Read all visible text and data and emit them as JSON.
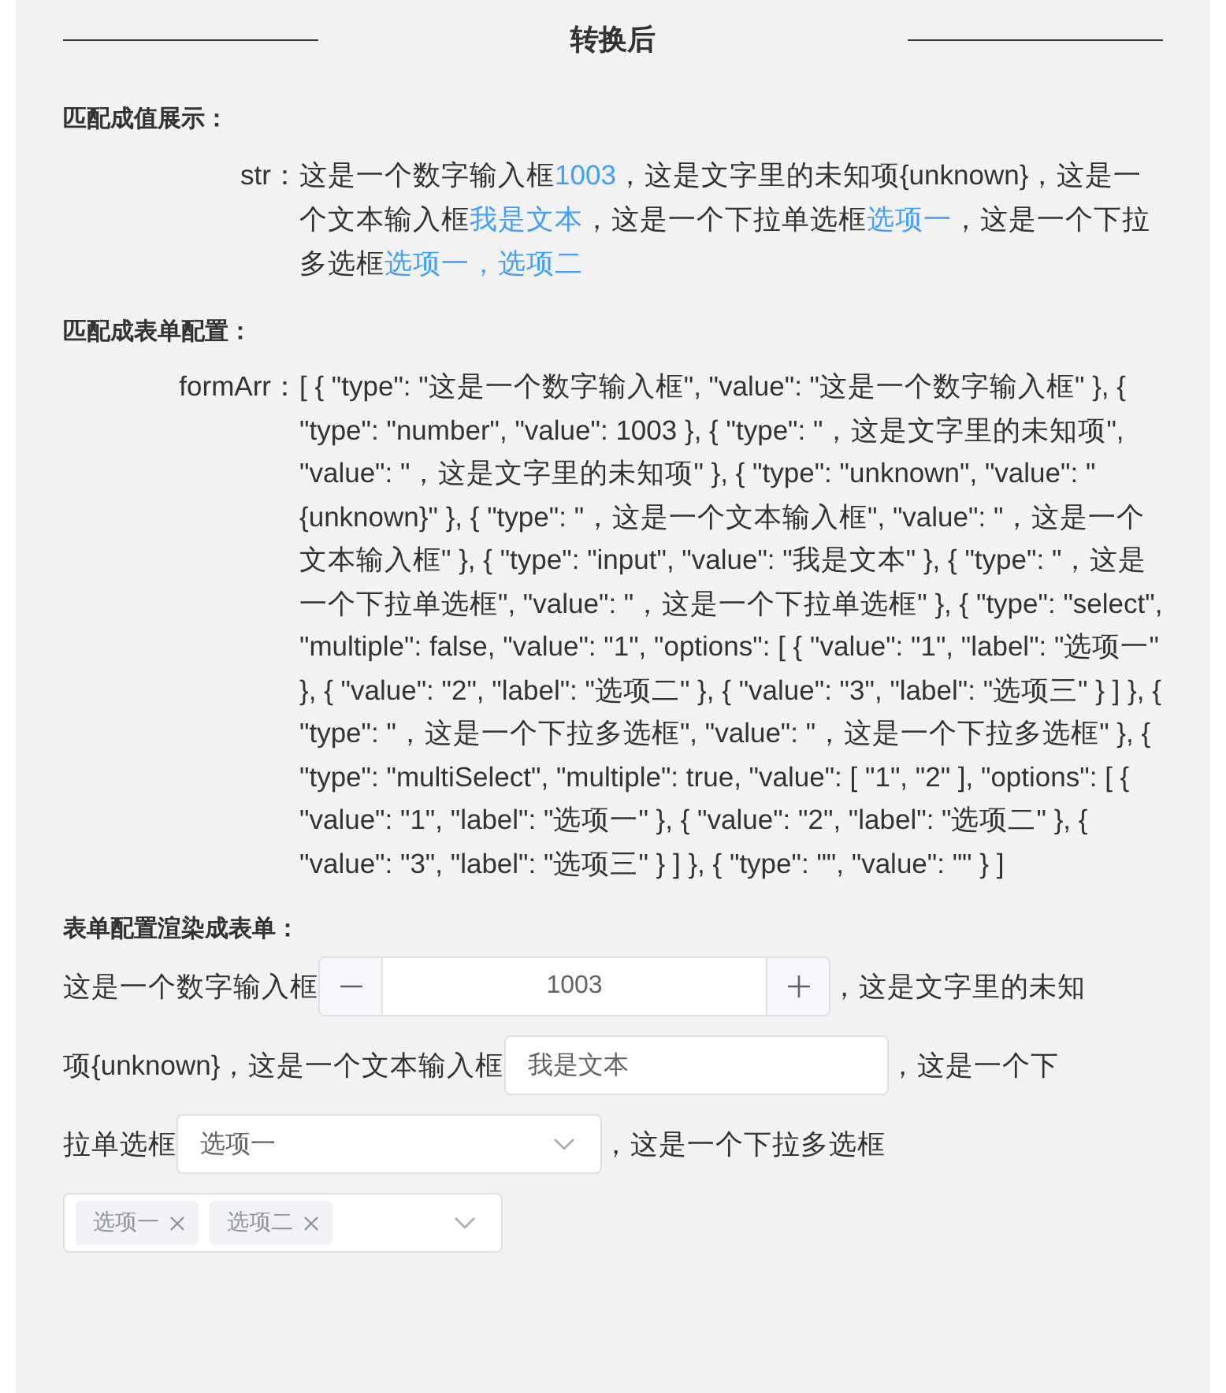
{
  "header": {
    "title": "转换后"
  },
  "value_section": {
    "heading": "匹配成值展示：",
    "label": "str：",
    "segments": [
      {
        "kind": "text",
        "text": "这是一个数字输入框"
      },
      {
        "kind": "value",
        "text": "1003"
      },
      {
        "kind": "text",
        "text": "，这是文字里的未知项{unknown}，这是一个文本输入框"
      },
      {
        "kind": "value",
        "text": "我是文本"
      },
      {
        "kind": "text",
        "text": "，这是一个下拉单选框"
      },
      {
        "kind": "value",
        "text": "选项一"
      },
      {
        "kind": "text",
        "text": "，这是一个下拉多选框"
      },
      {
        "kind": "value",
        "text": "选项一，选项二"
      }
    ]
  },
  "config_section": {
    "heading": "匹配成表单配置：",
    "label": "formArr：",
    "text": "[ { \"type\": \"这是一个数字输入框\", \"value\": \"这是一个数字输入框\" }, { \"type\": \"number\", \"value\": 1003 }, { \"type\": \"，这是文字里的未知项\", \"value\": \"，这是文字里的未知项\" }, { \"type\": \"unknown\", \"value\": \"{unknown}\" }, { \"type\": \"，这是一个文本输入框\", \"value\": \"，这是一个文本输入框\" }, { \"type\": \"input\", \"value\": \"我是文本\" }, { \"type\": \"，这是一个下拉单选框\", \"value\": \"，这是一个下拉单选框\" }, { \"type\": \"select\", \"multiple\": false, \"value\": \"1\", \"options\": [ { \"value\": \"1\", \"label\": \"选项一\" }, { \"value\": \"2\", \"label\": \"选项二\" }, { \"value\": \"3\", \"label\": \"选项三\" } ] }, { \"type\": \"，这是一个下拉多选框\", \"value\": \"，这是一个下拉多选框\" }, { \"type\": \"multiSelect\", \"multiple\": true, \"value\": [ \"1\", \"2\" ], \"options\": [ { \"value\": \"1\", \"label\": \"选项一\" }, { \"value\": \"2\", \"label\": \"选项二\" }, { \"value\": \"3\", \"label\": \"选项三\" } ] }, { \"type\": \"\", \"value\": \"\" } ]"
  },
  "form_section": {
    "heading": "表单配置渲染成表单：",
    "parts": [
      {
        "kind": "text",
        "text": "这是一个数字输入框"
      },
      {
        "kind": "number",
        "value": "1003"
      },
      {
        "kind": "text",
        "text": "，这是文字里的未知"
      },
      {
        "kind": "text",
        "text": "项{unknown}，这是一个文本输入框"
      },
      {
        "kind": "input",
        "value": "我是文本"
      },
      {
        "kind": "text",
        "text": "，这是一个下"
      },
      {
        "kind": "text",
        "text": "拉单选框"
      },
      {
        "kind": "select",
        "value": "选项一"
      },
      {
        "kind": "text",
        "text": "，这是一个下拉多选框"
      },
      {
        "kind": "multiselect",
        "tags": [
          "选项一",
          "选项二"
        ]
      }
    ]
  }
}
